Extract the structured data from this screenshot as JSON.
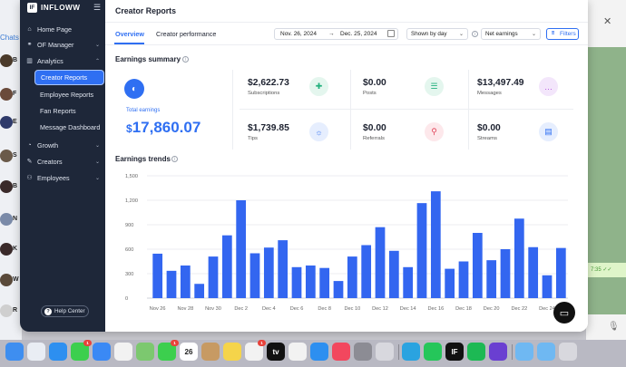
{
  "background": {
    "left_app": {
      "chats_label": "Chats",
      "letters": [
        "B",
        "F",
        "E",
        "S",
        "B",
        "N",
        "K",
        "W",
        "R"
      ]
    },
    "right_app": {
      "timestamp": "7:35 ✓✓"
    }
  },
  "sidebar": {
    "brand": "INFLOWW",
    "brand_logo_text": "IF",
    "items": [
      {
        "label": "Home Page",
        "icon": "home-icon"
      },
      {
        "label": "OF Manager",
        "icon": "of-icon"
      },
      {
        "label": "Analytics",
        "icon": "chart-icon"
      },
      {
        "label": "Creator Reports",
        "active": true
      },
      {
        "label": "Employee Reports"
      },
      {
        "label": "Fan Reports"
      },
      {
        "label": "Message Dashboard"
      },
      {
        "label": "Growth",
        "icon": "growth-icon"
      },
      {
        "label": "Creators",
        "icon": "creators-icon"
      },
      {
        "label": "Employees",
        "icon": "employees-icon"
      }
    ],
    "help_label": "Help Center"
  },
  "header": {
    "title": "Creator Reports"
  },
  "tabs": [
    {
      "label": "Overview",
      "active": true
    },
    {
      "label": "Creator performance",
      "active": false
    }
  ],
  "filters": {
    "date_start": "Nov. 26, 2024",
    "date_sep": "→",
    "date_end": "Dec. 25, 2024",
    "period": "Shown by day",
    "metric": "Net earnings",
    "button": "Filters"
  },
  "summary": {
    "title": "Earnings summary",
    "total_label": "Total earnings",
    "total_currency": "$",
    "total_value": "17,860.07",
    "stats": [
      {
        "value": "$2,622.73",
        "label": "Subscriptions",
        "icon": "subscriptions-icon",
        "color": "#22b07d"
      },
      {
        "value": "$0.00",
        "label": "Posts",
        "icon": "posts-icon",
        "color": "#22b07d"
      },
      {
        "value": "$13,497.49",
        "label": "Messages",
        "icon": "messages-icon",
        "color": "#b44ee0"
      },
      {
        "value": "$1,739.85",
        "label": "Tips",
        "icon": "tips-icon",
        "color": "#2f6ff2"
      },
      {
        "value": "$0.00",
        "label": "Referrals",
        "icon": "referrals-icon",
        "color": "#e0455a"
      },
      {
        "value": "$0.00",
        "label": "Streams",
        "icon": "streams-icon",
        "color": "#2f6ff2"
      }
    ]
  },
  "chart_title": "Earnings trends",
  "chart_data": {
    "type": "bar",
    "title": "Earnings trends",
    "categories": [
      "Nov 26",
      "Nov 27",
      "Nov 28",
      "Nov 29",
      "Nov 30",
      "Dec 1",
      "Dec 2",
      "Dec 3",
      "Dec 4",
      "Dec 5",
      "Dec 6",
      "Dec 7",
      "Dec 8",
      "Dec 9",
      "Dec 10",
      "Dec 11",
      "Dec 12",
      "Dec 13",
      "Dec 14",
      "Dec 15",
      "Dec 16",
      "Dec 17",
      "Dec 18",
      "Dec 19",
      "Dec 20",
      "Dec 21",
      "Dec 22",
      "Dec 23",
      "Dec 24",
      "Dec 25"
    ],
    "tick_labels": [
      "Nov 26",
      "Nov 28",
      "Nov 30",
      "Dec 2",
      "Dec 4",
      "Dec 6",
      "Dec 8",
      "Dec 10",
      "Dec 12",
      "Dec 14",
      "Dec 16",
      "Dec 18",
      "Dec 20",
      "Dec 22",
      "Dec 24"
    ],
    "values": [
      545,
      335,
      400,
      175,
      510,
      770,
      1200,
      550,
      620,
      710,
      380,
      400,
      370,
      210,
      510,
      650,
      870,
      580,
      380,
      1165,
      1310,
      360,
      450,
      800,
      465,
      600,
      975,
      625,
      280,
      615
    ],
    "ylim": [
      0,
      1500
    ],
    "yticks": [
      "0",
      "300",
      "600",
      "900",
      "1,200",
      "1,500"
    ],
    "ytick_values": [
      0,
      300,
      600,
      900,
      1200,
      1500
    ],
    "color": "#3366f0",
    "grid": true
  },
  "dock": [
    {
      "name": "finder-icon",
      "color": "#3e8ef0"
    },
    {
      "name": "launchpad-icon",
      "color": "#e9edf4"
    },
    {
      "name": "safari-icon",
      "color": "#2d8ff0"
    },
    {
      "name": "messages-app-icon",
      "color": "#3ccf4e",
      "badge": "1"
    },
    {
      "name": "mail-icon",
      "color": "#3a89f5"
    },
    {
      "name": "photos-icon",
      "color": "#f2f2f2"
    },
    {
      "name": "maps-icon",
      "color": "#7cc86f"
    },
    {
      "name": "facetime-icon",
      "color": "#3ccf4e",
      "badge": "1"
    },
    {
      "name": "calendar-icon",
      "color": "#ffffff",
      "text": "26"
    },
    {
      "name": "contacts-icon",
      "color": "#c79a63"
    },
    {
      "name": "notes-icon",
      "color": "#f5d44a"
    },
    {
      "name": "reminders-icon",
      "color": "#f2f2f2",
      "badge": "1"
    },
    {
      "name": "tv-icon",
      "color": "#111111",
      "text": "tv"
    },
    {
      "name": "freeform-icon",
      "color": "#f2f2f2"
    },
    {
      "name": "app-store-icon",
      "color": "#2d8ff0"
    },
    {
      "name": "music-icon",
      "color": "#f2475e"
    },
    {
      "name": "settings-icon",
      "color": "#8c8c94"
    },
    {
      "name": "preview-icon",
      "color": "#d8d8de"
    },
    {
      "name": "telegram-icon",
      "color": "#2aa3e0"
    },
    {
      "name": "whatsapp-icon",
      "color": "#25c65a"
    },
    {
      "name": "infloww-icon",
      "color": "#111111",
      "text": "IF"
    },
    {
      "name": "spotify-icon",
      "color": "#1db954"
    },
    {
      "name": "arc-icon",
      "color": "#6a3fd1"
    },
    {
      "name": "folder-icon",
      "color": "#6fb8f2"
    },
    {
      "name": "downloads-folder-icon",
      "color": "#6fb8f2"
    },
    {
      "name": "trash-icon",
      "color": "#d8d8de"
    }
  ]
}
